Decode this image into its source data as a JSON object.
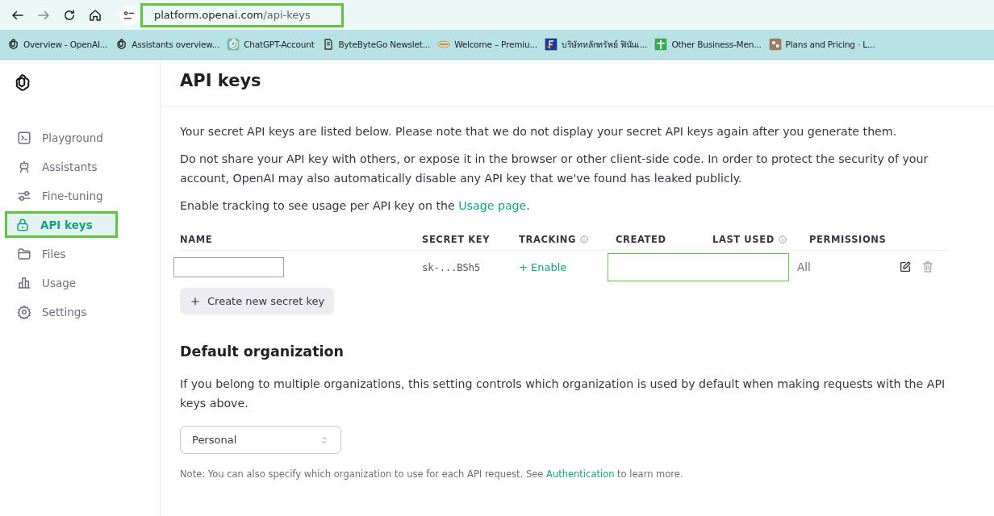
{
  "browser": {
    "url_host": "platform.openai.com",
    "url_path": "/api-keys",
    "url_highlighted": true,
    "bookmarks": [
      {
        "label": "Overview - OpenAI...",
        "kind": "openai"
      },
      {
        "label": "Assistants overview...",
        "kind": "openai"
      },
      {
        "label": "ChatGPT-Account",
        "kind": "chatgpt"
      },
      {
        "label": "ByteByteGo Newslet...",
        "kind": "bytebyte"
      },
      {
        "label": "Welcome – Premiu...",
        "kind": "emblem"
      },
      {
        "label": "บริษัทหลักทรัพย์ ฟินันเ...",
        "kind": "f"
      },
      {
        "label": "Other Business-Men...",
        "kind": "cross"
      },
      {
        "label": "Plans and Pricing · L...",
        "kind": "puzzle"
      }
    ]
  },
  "sidebar": {
    "items": [
      {
        "label": "Playground",
        "kind": "terminal",
        "selected": false,
        "highlighted": false
      },
      {
        "label": "Assistants",
        "kind": "robot",
        "selected": false,
        "highlighted": false
      },
      {
        "label": "Fine-tuning",
        "kind": "sliders",
        "selected": false,
        "highlighted": false
      },
      {
        "label": "API keys",
        "kind": "lock",
        "selected": true,
        "highlighted": true
      },
      {
        "label": "Files",
        "kind": "folder",
        "selected": false,
        "highlighted": false
      },
      {
        "label": "Usage",
        "kind": "chart",
        "selected": false,
        "highlighted": false
      },
      {
        "label": "Settings",
        "kind": "gear",
        "selected": false,
        "highlighted": false
      }
    ]
  },
  "page": {
    "title": "API keys",
    "intro": "Your secret API keys are listed below. Please note that we do not display your secret API keys again after you generate them.",
    "warning": "Do not share your API key with others, or expose it in the browser or other client-side code. In order to protect the security of your account, OpenAI may also automatically disable any API key that we've found has leaked publicly.",
    "tracking_text": "Enable tracking to see usage per API key on the",
    "tracking_link": "Usage page",
    "tracking_end": ".",
    "table": {
      "columns": [
        {
          "label": "NAME",
          "info": false
        },
        {
          "label": "SECRET KEY",
          "info": false
        },
        {
          "label": "TRACKING",
          "info": true
        },
        {
          "label": "CREATED",
          "info": false
        },
        {
          "label": "LAST USED",
          "info": true
        },
        {
          "label": "PERMISSIONS",
          "info": false
        }
      ],
      "rows": [
        {
          "name_redacted": true,
          "secret_key": "sk-...BSh5",
          "tracking": "+ Enable",
          "created_redacted": true,
          "permissions": "All"
        }
      ]
    },
    "create_button": "Create new secret key",
    "org_title": "Default organization",
    "org_text": "If you belong to multiple organizations, this setting controls which organization is used by default when making requests with the API keys above.",
    "org_select": "Personal",
    "note_text": "Note: You can also specify which organization to use for each API request. See",
    "note_link": "Authentication",
    "note_end": "to learn more."
  }
}
